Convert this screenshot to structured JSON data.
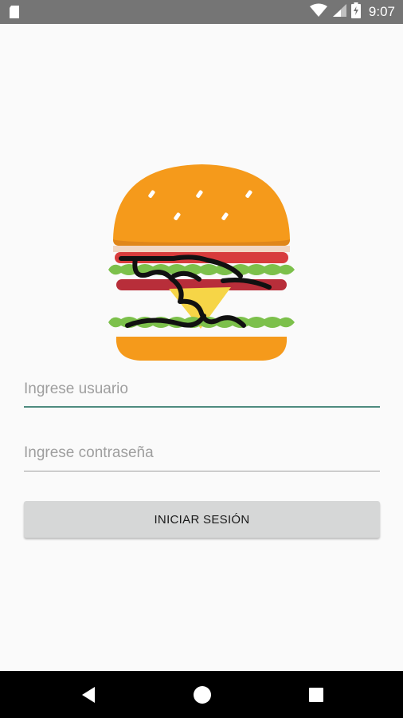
{
  "status_bar": {
    "time": "9:07",
    "left_icon": "sd-card-icon",
    "right_icons": [
      "wifi-icon",
      "signal-icon",
      "battery-icon"
    ]
  },
  "logo": {
    "icon": "hamburger-icon",
    "colors": {
      "bun": "#f59a1b",
      "sesame": "#ffffff",
      "lettuce": "#7cc04b",
      "tomato": "#d83c3c",
      "cheese": "#f6d547",
      "outline": "#111111"
    }
  },
  "login_form": {
    "username_placeholder": "Ingrese usuario",
    "username_value": "",
    "password_placeholder": "Ingrese contraseña",
    "password_value": "",
    "submit_label": "INICIAR SESIÓN"
  },
  "colors": {
    "background": "#fafafa",
    "status_bar": "#757575",
    "focus_underline": "#4e8b7f",
    "button": "#d6d7d7",
    "nav_bar": "#000000"
  },
  "nav_bar": {
    "buttons": [
      "back-icon",
      "home-icon",
      "recents-icon"
    ]
  }
}
